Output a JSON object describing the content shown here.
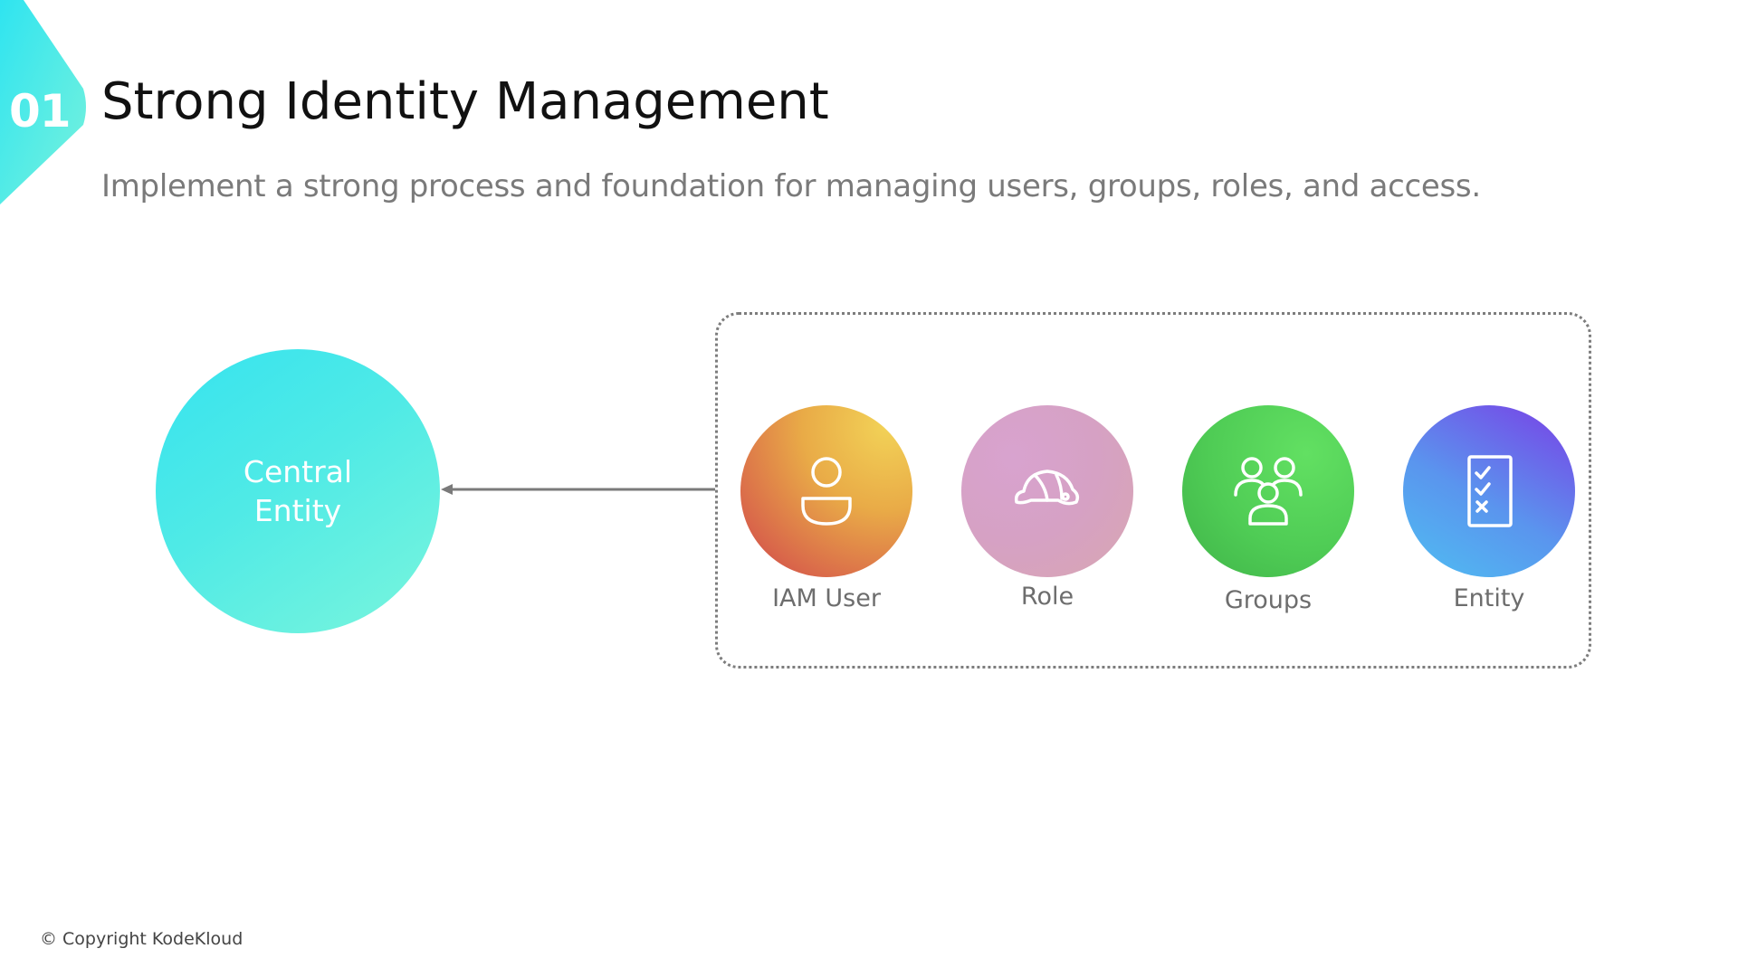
{
  "badge": {
    "number": "01"
  },
  "header": {
    "title": "Strong Identity Management",
    "subtitle": "Implement a strong process and foundation for managing users, groups, roles, and access."
  },
  "central": {
    "label": "Central Entity"
  },
  "group": {
    "items": [
      {
        "label": "IAM User",
        "icon": "user-icon"
      },
      {
        "label": "Role",
        "icon": "hard-hat-icon"
      },
      {
        "label": "Groups",
        "icon": "users-group-icon"
      },
      {
        "label": "Entity",
        "icon": "checklist-icon"
      }
    ]
  },
  "footer": {
    "copyright": "© Copyright KodeKloud"
  },
  "colors": {
    "badge": "#3ee6ef",
    "central": "#4feae6",
    "iam_user": "#e9ab47",
    "role": "#d6a1c4",
    "groups": "#4fcc55",
    "entity": "#5a95ee"
  }
}
